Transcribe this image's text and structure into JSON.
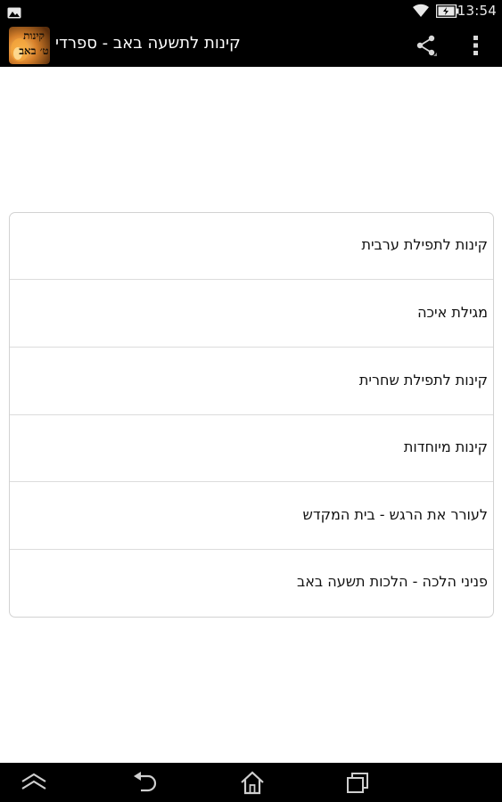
{
  "status_bar": {
    "time": "13:54",
    "icons": [
      "picture-notification-icon",
      "wifi-icon",
      "battery-charging-icon"
    ]
  },
  "action_bar": {
    "title": "קינות לתשעה באב - ספרדי",
    "app_icon_label": "קינות ט׳ באב",
    "icons": [
      "app-icon",
      "share-icon",
      "overflow-menu-icon"
    ]
  },
  "menu": {
    "items": [
      {
        "label": "קינות לתפילת ערבית"
      },
      {
        "label": "מגילת איכה"
      },
      {
        "label": "קינות לתפילת שחרית"
      },
      {
        "label": "קינות מיוחדות"
      },
      {
        "label": "לעורר את הרגש - בית המקדש"
      },
      {
        "label": "פניני הלכה - הלכות תשעה באב"
      }
    ]
  },
  "nav_bar": {
    "icons": [
      "menu-up-icon",
      "back-icon",
      "home-icon",
      "recent-apps-icon"
    ]
  },
  "colors": {
    "bars": "#000000",
    "background": "#ffffff",
    "divider": "#dcdcdc",
    "text": "#111111"
  }
}
